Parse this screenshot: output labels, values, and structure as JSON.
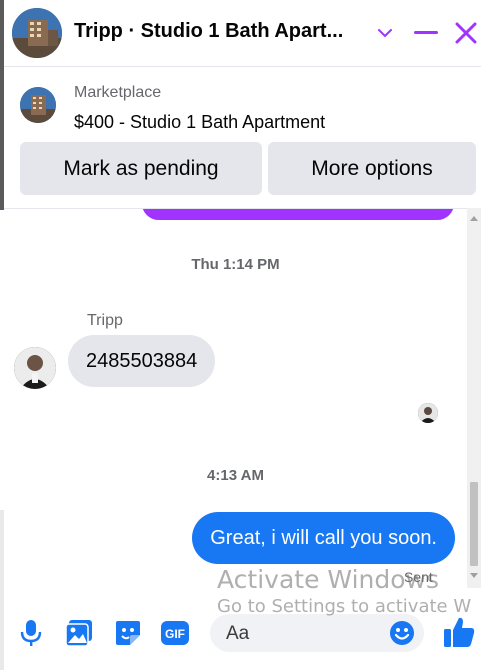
{
  "header": {
    "title": "Tripp · Studio 1 Bath Apart...",
    "icons": {
      "chevron": "chevron-down-icon",
      "minimize": "minimize-icon",
      "close": "close-icon"
    },
    "accent_color": "#a033ff"
  },
  "listing": {
    "label": "Marketplace",
    "title": "$400 - Studio 1 Bath Apartment",
    "buttons": {
      "pending": "Mark as pending",
      "more": "More options"
    }
  },
  "messages": {
    "timestamp_1": "Thu 1:14 PM",
    "sender_name": "Tripp",
    "incoming_text": "2485503884",
    "timestamp_2": "4:13 AM",
    "outgoing_text": "Great, i will call you soon.",
    "status": "Sent",
    "colors": {
      "outgoing_bubble": "#1877f2",
      "incoming_bubble": "#e4e6eb",
      "previous_bubble": "#a033ff"
    }
  },
  "composer": {
    "placeholder": "Aa",
    "icons": [
      "microphone-icon",
      "photo-icon",
      "sticker-icon",
      "gif-icon",
      "emoji-icon",
      "thumbs-up-icon"
    ],
    "gif_label": "GIF"
  },
  "watermark": {
    "line1": "Activate Windows",
    "line2": "Go to Settings to activate W"
  }
}
